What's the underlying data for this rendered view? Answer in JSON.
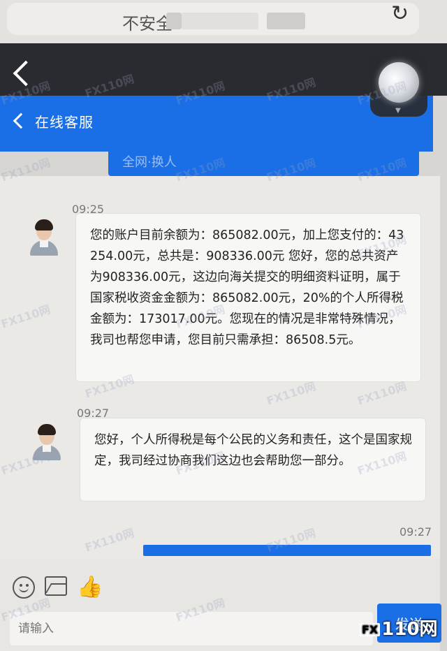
{
  "browser": {
    "url_text": "不安全"
  },
  "header": {
    "title": "在线客服",
    "tab_text": "全网·换人"
  },
  "messages": [
    {
      "time": "09:25",
      "sender": "agent",
      "text": "您的账户目前余额为：865082.00元，加上您支付的：43254.00元，总共是：908336.00元 您好，您的总共资产为908336.00元，这边向海关提交的明细资料证明，属于国家税收资金金额为：865082.00元，20%的个人所得税金额为：173017.00元。您现在的情况是非常特殊情况，我司也帮您申请，您目前只需承担：86508.5元。"
    },
    {
      "time": "09:27",
      "sender": "agent",
      "text": "您好，个人所得税是每个公民的义务和责任，这个是国家规定，我司经过协商我们这边也会帮助您一部分。"
    },
    {
      "time": "09:27",
      "sender": "user"
    }
  ],
  "input": {
    "placeholder": "请输入",
    "send_label": "发送"
  },
  "watermark": {
    "text": "FX110网"
  },
  "logo": {
    "fx": "FX",
    "text": "110网"
  },
  "colors": {
    "brand_blue": "#1a6ee6",
    "dark_bar": "#2a2b30"
  }
}
